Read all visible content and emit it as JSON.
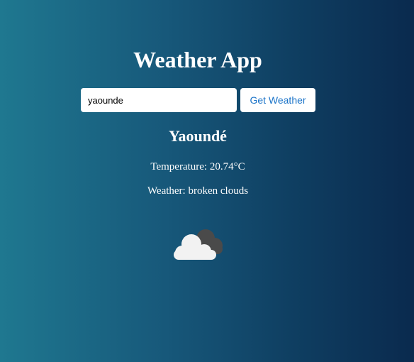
{
  "app": {
    "title": "Weather App"
  },
  "search": {
    "value": "yaounde",
    "button_label": "Get Weather"
  },
  "result": {
    "city": "Yaoundé",
    "temperature_label": "Temperature:",
    "temperature_value": "20.74°C",
    "weather_label": "Weather:",
    "weather_value": "broken clouds",
    "icon": "broken-clouds-icon"
  }
}
